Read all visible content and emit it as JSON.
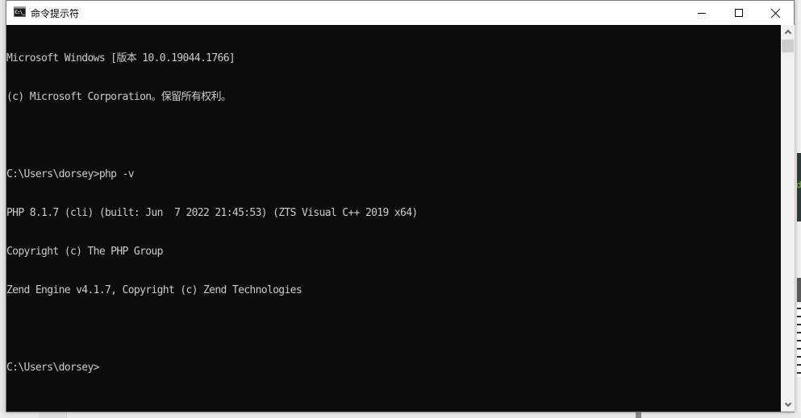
{
  "window": {
    "title": "命令提示符",
    "icon": "console-icon",
    "icon_text": "C:\\_",
    "controls": {
      "minimize": "minimize-icon",
      "maximize": "maximize-icon",
      "close": "close-icon"
    }
  },
  "console": {
    "lines": [
      "Microsoft Windows [版本 10.0.19044.1766]",
      "(c) Microsoft Corporation。保留所有权利。",
      "",
      "C:\\Users\\dorsey>php -v",
      "PHP 8.1.7 (cli) (built: Jun  7 2022 21:45:53) (ZTS Visual C++ 2019 x64)",
      "Copyright (c) The PHP Group",
      "Zend Engine v4.1.7, Copyright (c) Zend Technologies",
      "",
      "C:\\Users\\dorsey>"
    ],
    "colors": {
      "background": "#0c0c0c",
      "foreground": "#cccccc"
    }
  },
  "scrollbar": {
    "up": "chevron-up-icon",
    "down": "chevron-down-icon"
  },
  "background": {
    "partial_text": "d"
  }
}
